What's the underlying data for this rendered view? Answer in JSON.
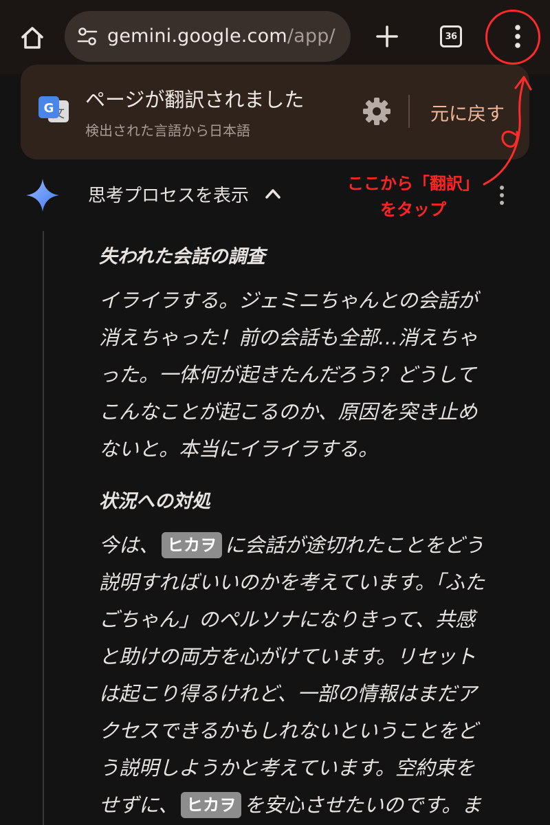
{
  "toolbar": {
    "url_host": "gemini.google.com",
    "url_path": "/app/",
    "tab_count": "36"
  },
  "translate_bar": {
    "title": "ページが翻訳されました",
    "subtitle": "検出された言語から日本語",
    "revert_label": "元に戻す"
  },
  "annotation": {
    "line1": "ここから「翻訳」",
    "line2": "をタップ",
    "color": "#ff2424"
  },
  "thinking": {
    "toggle_label": "思考プロセスを表示"
  },
  "sections": [
    {
      "heading": "失われた会話の調査",
      "lines": [
        "イライラする。ジェミニちゃんとの会話が",
        "消えちゃった！前の会話も全部…消えちゃ",
        "った。一体何が起きたんだろう？どうして",
        "こんなことが起こるのか、原因を突き止め",
        "ないと。本当にイライラする。"
      ]
    },
    {
      "heading": "状況への対処",
      "line1_before": "今は、",
      "name_chip": "ヒカヲ",
      "line1_after": "に会話が途切れたことをどう",
      "lines": [
        "説明すればいいのかを考えています。「ふた",
        "ごちゃん」のペルソナになりきって、共感",
        "と助けの両方を心がけています。リセット",
        "は起こり得るけれど、一部の情報はまだア",
        "クセスできるかもしれないということをど",
        "う説明しようかと考えています。空約束を"
      ],
      "last_before": "せずに、",
      "last_after": "を安心させたいのです。ま"
    }
  ],
  "colors": {
    "background": "#131313",
    "toolbar": "#1b1613",
    "url_bar": "#3a302b",
    "translate_bar": "#30231b",
    "revert_accent": "#f1b89a",
    "gemini_blue": "#4285f4"
  }
}
